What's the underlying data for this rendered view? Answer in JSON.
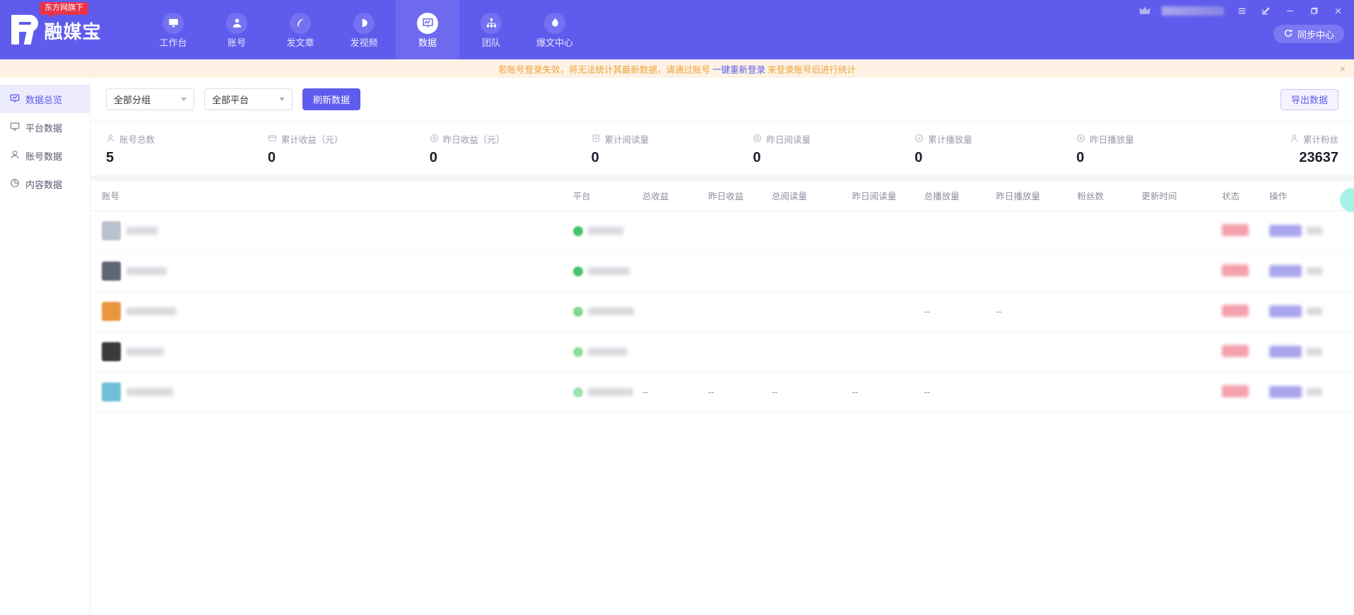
{
  "app": {
    "brand_badge": "东方网旗下",
    "brand_name": "融媒宝",
    "sync_label": "同步中心"
  },
  "topnav": {
    "items": [
      {
        "label": "工作台",
        "icon": "monitor-icon",
        "active": false
      },
      {
        "label": "账号",
        "icon": "user-icon",
        "active": false
      },
      {
        "label": "发文章",
        "icon": "feather-icon",
        "active": false
      },
      {
        "label": "发视频",
        "icon": "play-circle-icon",
        "active": false
      },
      {
        "label": "数据",
        "icon": "chart-monitor-icon",
        "active": true
      },
      {
        "label": "团队",
        "icon": "org-tree-icon",
        "active": false
      },
      {
        "label": "爆文中心",
        "icon": "flame-icon",
        "active": false
      }
    ]
  },
  "window_controls": {
    "menu": "menu-icon",
    "edit": "edit-icon",
    "minimize": "minimize-icon",
    "maximize": "maximize-icon",
    "close": "close-icon"
  },
  "warning": {
    "text_before": "若账号登录失效，将无法统计其最新数据，请通过账号",
    "link": "一键重新登录",
    "text_after": "来登录账号后进行统计",
    "close": "×",
    "color": "#f0a33a",
    "link_color": "#5f5ced",
    "background": "#fdf2e3"
  },
  "sidebar": {
    "items": [
      {
        "label": "数据总览",
        "icon": "overview-icon",
        "active": true
      },
      {
        "label": "平台数据",
        "icon": "monitor-icon",
        "active": false
      },
      {
        "label": "账号数据",
        "icon": "user-icon",
        "active": false
      },
      {
        "label": "内容数据",
        "icon": "pie-chart-icon",
        "active": false
      }
    ]
  },
  "toolbar": {
    "group_filter": "全部分组",
    "platform_filter": "全部平台",
    "refresh_label": "刷新数据",
    "export_label": "导出数据"
  },
  "stats": [
    {
      "label": "账号总数",
      "value": "5",
      "icon": "user-icon"
    },
    {
      "label": "累计收益（元）",
      "value": "0",
      "icon": "wallet-icon"
    },
    {
      "label": "昨日收益（元）",
      "value": "0",
      "icon": "coin-icon"
    },
    {
      "label": "累计阅读量",
      "value": "0",
      "icon": "document-icon"
    },
    {
      "label": "昨日阅读量",
      "value": "0",
      "icon": "eye-icon"
    },
    {
      "label": "累计播放量",
      "value": "0",
      "icon": "check-circle-icon"
    },
    {
      "label": "昨日播放量",
      "value": "0",
      "icon": "play-circle-icon"
    },
    {
      "label": "累计粉丝",
      "value": "23637",
      "icon": "fans-icon"
    }
  ],
  "table": {
    "columns": [
      "账号",
      "平台",
      "总收益",
      "昨日收益",
      "总阅读量",
      "昨日阅读量",
      "总播放量",
      "昨日播放量",
      "粉丝数",
      "更新时间",
      "状态",
      "操作"
    ],
    "rows": [
      {
        "avatar_color": "#b9c2cc",
        "account_redacted": true,
        "platform_color": "#44c46a",
        "total_income": "",
        "yesterday_income": "",
        "total_reads": "",
        "yesterday_reads": "",
        "total_plays": "",
        "yesterday_plays": "",
        "fans": "",
        "update_time": "",
        "status_redacted": true,
        "action_redacted": true
      },
      {
        "avatar_color": "#5c6675",
        "account_redacted": true,
        "platform_color": "#44c46a",
        "total_income": "",
        "yesterday_income": "",
        "total_reads": "",
        "yesterday_reads": "",
        "total_plays": "",
        "yesterday_plays": "",
        "fans": "",
        "update_time": "",
        "status_redacted": true,
        "action_redacted": true
      },
      {
        "avatar_color": "#e8973f",
        "account_redacted": true,
        "platform_color": "#7fd98f",
        "total_income": "",
        "yesterday_income": "",
        "total_reads": "",
        "yesterday_reads": "",
        "total_plays": "--",
        "yesterday_plays": "--",
        "fans": "",
        "update_time": "",
        "status_redacted": true,
        "action_redacted": true
      },
      {
        "avatar_color": "#3a3a3a",
        "account_redacted": true,
        "platform_color": "#8fdc9c",
        "total_income": "",
        "yesterday_income": "",
        "total_reads": "",
        "yesterday_reads": "",
        "total_plays": "",
        "yesterday_plays": "",
        "fans": "",
        "update_time": "",
        "status_redacted": true,
        "action_redacted": true
      },
      {
        "avatar_color": "#6fc0d8",
        "account_redacted": true,
        "platform_color": "#9fe0ab",
        "total_income": "--",
        "yesterday_income": "--",
        "total_reads": "--",
        "yesterday_reads": "--",
        "total_plays": "--",
        "yesterday_plays": "",
        "fans": "",
        "update_time": "",
        "status_redacted": true,
        "action_redacted": true
      }
    ]
  },
  "theme": {
    "primary": "#5f5ced",
    "nav_active": "#6d6af0",
    "sidebar_active_bg": "#eceafd",
    "warning_bg": "#fdf2e3",
    "page_bg": "#f5f5f7"
  }
}
